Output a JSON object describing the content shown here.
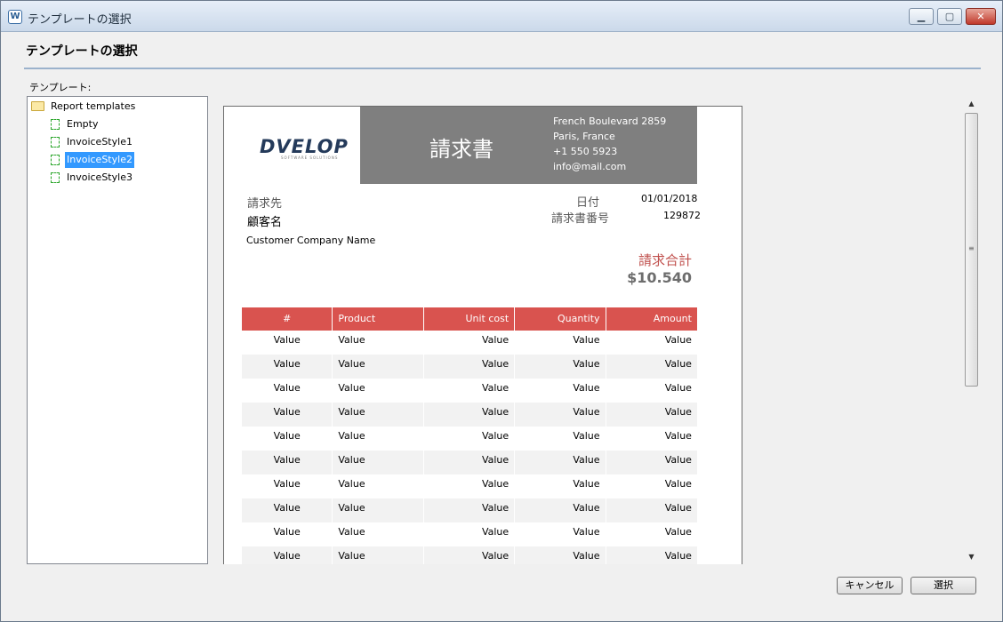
{
  "window": {
    "title": "テンプレートの選択",
    "heading": "テンプレートの選択"
  },
  "tree": {
    "label": "テンプレート:",
    "root": "Report templates",
    "items": [
      {
        "label": "Empty",
        "selected": false
      },
      {
        "label": "InvoiceStyle1",
        "selected": false
      },
      {
        "label": "InvoiceStyle2",
        "selected": true
      },
      {
        "label": "InvoiceStyle3",
        "selected": false
      }
    ]
  },
  "invoice": {
    "logo": "DVELOP",
    "logo_sub": "SOFTWARE SOLUTIONS",
    "title": "請求書",
    "address": [
      "French Boulevard 2859",
      "Paris, France",
      "+1 550 5923",
      "info@mail.com"
    ],
    "bill_to_label": "請求先",
    "customer_name": "顧客名",
    "company": "Customer Company Name",
    "date_label": "日付",
    "date_value": "01/01/2018",
    "number_label": "請求書番号",
    "number_value": "129872",
    "total_label": "請求合計",
    "total_value": "$10.540",
    "columns": [
      "#",
      "Product",
      "Unit cost",
      "Quantity",
      "Amount"
    ],
    "rows": [
      [
        "Value",
        "Value",
        "Value",
        "Value",
        "Value"
      ],
      [
        "Value",
        "Value",
        "Value",
        "Value",
        "Value"
      ],
      [
        "Value",
        "Value",
        "Value",
        "Value",
        "Value"
      ],
      [
        "Value",
        "Value",
        "Value",
        "Value",
        "Value"
      ],
      [
        "Value",
        "Value",
        "Value",
        "Value",
        "Value"
      ],
      [
        "Value",
        "Value",
        "Value",
        "Value",
        "Value"
      ],
      [
        "Value",
        "Value",
        "Value",
        "Value",
        "Value"
      ],
      [
        "Value",
        "Value",
        "Value",
        "Value",
        "Value"
      ],
      [
        "Value",
        "Value",
        "Value",
        "Value",
        "Value"
      ],
      [
        "Value",
        "Value",
        "Value",
        "Value",
        "Value"
      ]
    ]
  },
  "buttons": {
    "cancel": "キャンセル",
    "ok": "選択"
  },
  "colors": {
    "table_header": "#d9534f",
    "total_label": "#c0504d",
    "header_band": "#7f7f7f",
    "selection": "#3399ff"
  }
}
